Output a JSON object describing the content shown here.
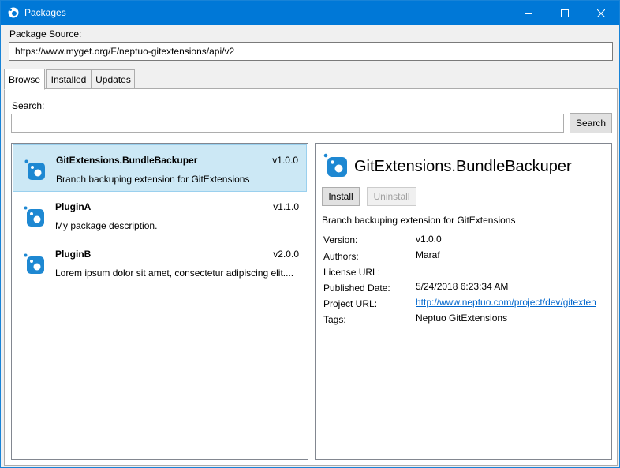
{
  "window": {
    "title": "Packages"
  },
  "source": {
    "label": "Package Source:",
    "value": "https://www.myget.org/F/neptuo-gitextensions/api/v2"
  },
  "tabs": [
    {
      "label": "Browse"
    },
    {
      "label": "Installed"
    },
    {
      "label": "Updates"
    }
  ],
  "search": {
    "label": "Search:",
    "value": "",
    "button": "Search"
  },
  "packages": [
    {
      "name": "GitExtensions.BundleBackuper",
      "version": "v1.0.0",
      "description": "Branch backuping extension for GitExtensions"
    },
    {
      "name": "PluginA",
      "version": "v1.1.0",
      "description": "My package description."
    },
    {
      "name": "PluginB",
      "version": "v2.0.0",
      "description": "Lorem ipsum dolor sit amet, consectetur adipiscing elit...."
    }
  ],
  "detail": {
    "title": "GitExtensions.BundleBackuper",
    "install_label": "Install",
    "uninstall_label": "Uninstall",
    "description": "Branch backuping extension for GitExtensions",
    "fields": {
      "version_label": "Version:",
      "version": "v1.0.0",
      "authors_label": "Authors:",
      "authors": "Maraf",
      "license_label": "License URL:",
      "license": "",
      "published_label": "Published Date:",
      "published": "5/24/2018 6:23:34 AM",
      "project_label": "Project URL:",
      "project": "http://www.neptuo.com/project/dev/gitexten",
      "tags_label": "Tags:",
      "tags": "Neptuo GitExtensions"
    }
  },
  "icons": {
    "app": "nuget-package-icon",
    "package": "nuget-package-icon",
    "minimize": "minimize-icon",
    "maximize": "maximize-icon",
    "close": "close-icon"
  },
  "colors": {
    "titlebar": "#0078d7",
    "selection": "#cce8f5",
    "link": "#0066cc",
    "package_icon": "#1e88d2"
  }
}
